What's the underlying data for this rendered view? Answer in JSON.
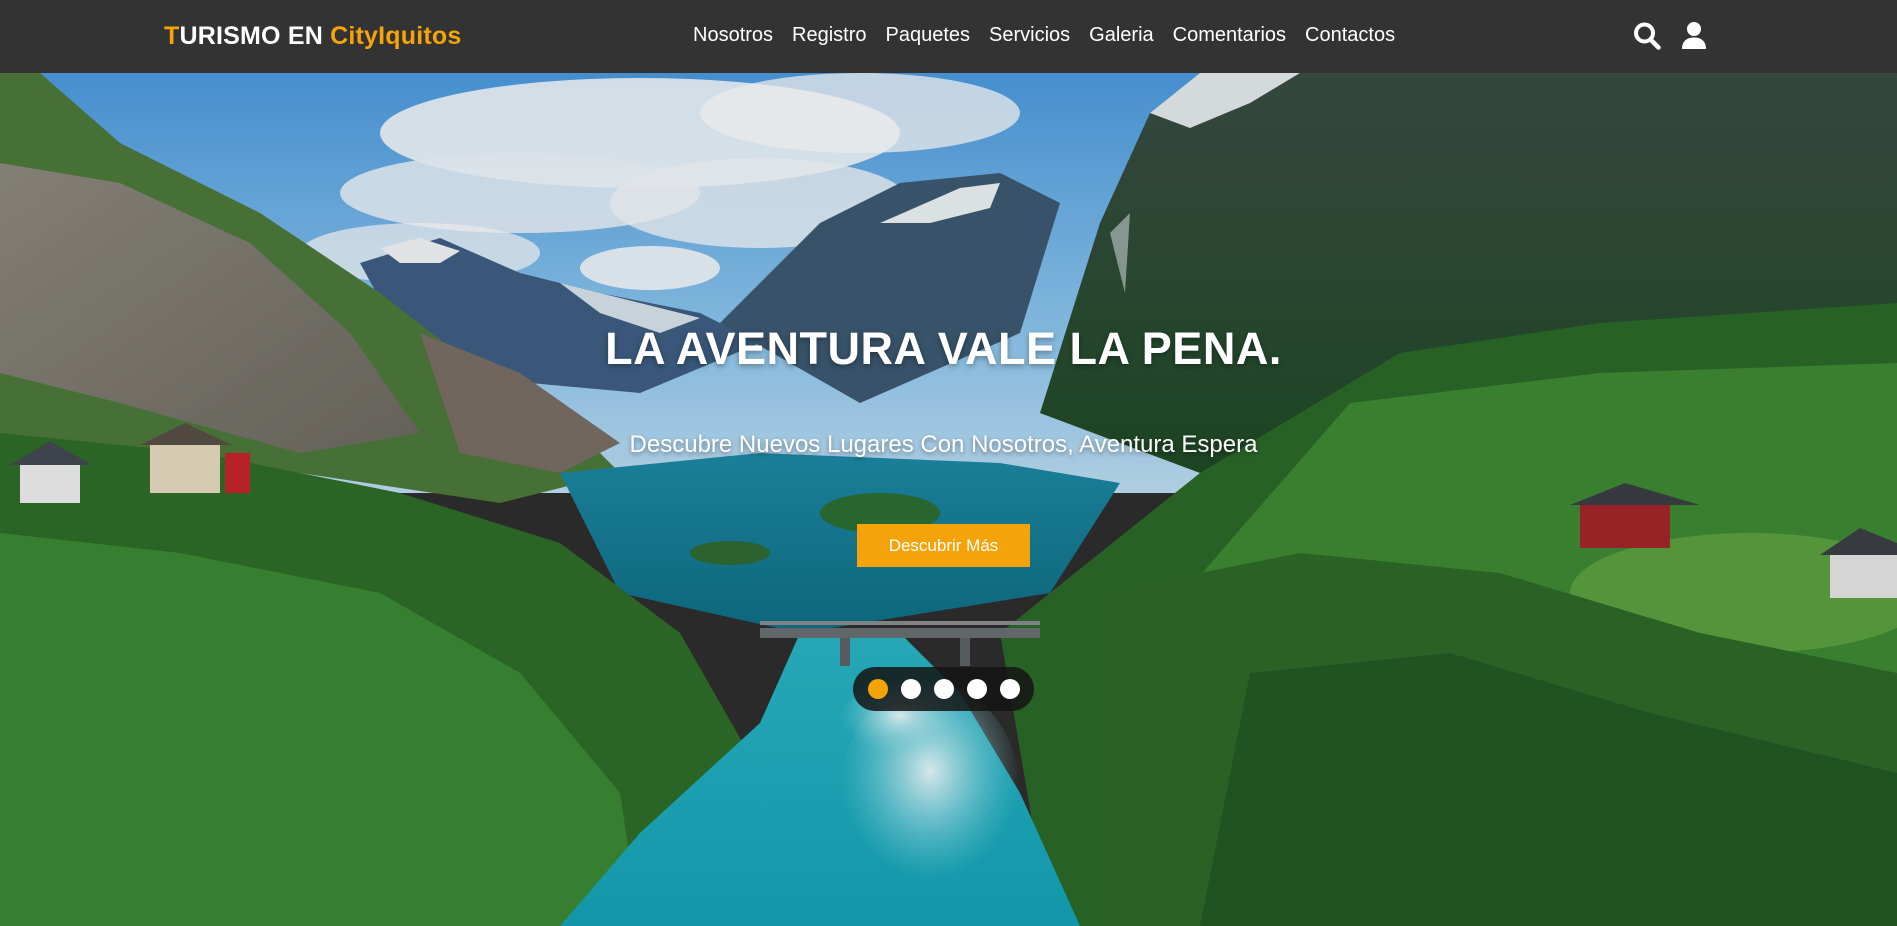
{
  "header": {
    "logo": {
      "first": "T",
      "middle": "URISMO EN ",
      "accent": "CityIquitos"
    },
    "nav": [
      "Nosotros",
      "Registro",
      "Paquetes",
      "Servicios",
      "Galeria",
      "Comentarios",
      "Contactos"
    ],
    "icons": [
      "search-icon",
      "user-icon"
    ]
  },
  "hero": {
    "title": "LA AVENTURA VALE LA PENA.",
    "subtitle": "Descubre Nuevos Lugares Con Nosotros, Aventura Espera",
    "button_label": "Descubrir Más",
    "slides_total": 5,
    "active_slide": 1
  },
  "colors": {
    "accent": "#f5a30a",
    "header_bg": "#333333",
    "text": "#ffffff"
  }
}
